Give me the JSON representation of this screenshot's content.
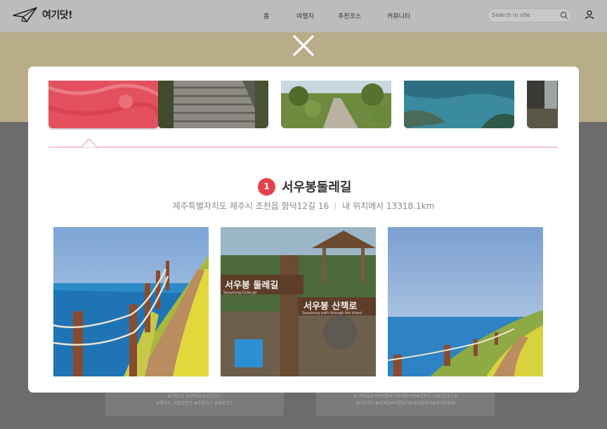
{
  "header": {
    "brand": "여기닷!",
    "nav": [
      "홈",
      "여행지",
      "추천코스",
      "커뮤니티"
    ],
    "search": {
      "placeholder": "Search in site"
    }
  },
  "modal": {
    "place": {
      "number": "1",
      "name": "서우봉둘레길",
      "address": "제주특별자치도 제주시 조천읍 함덕12길 16",
      "distance": "내 위치에서 13318.1km"
    },
    "photo_sign_upper": "서우봉 둘레길",
    "photo_sign_upper_en": "Seoubong Dulle-gil",
    "photo_sign_lower": "서우봉 산책로",
    "photo_sign_lower_en": "Seoubong path through the island"
  },
  "background_cards": [
    {
      "tags_line1": "#1박2일 #2박3일#당일코스",
      "tags_line2": "#제주도_가볼만한곳 #추천코스 #힐링코스"
    },
    {
      "tags_line1": "#1박2일#가족여행#가족체험여행#가족코스#당일코스#",
      "tags_line2": "데이트코스#사계절#이름유가#영화촬영지#자녀와함께"
    }
  ],
  "colors": {
    "accent": "#e5414c",
    "header_bg": "#bcbcbc",
    "overlay_band": "#b9ad89"
  }
}
